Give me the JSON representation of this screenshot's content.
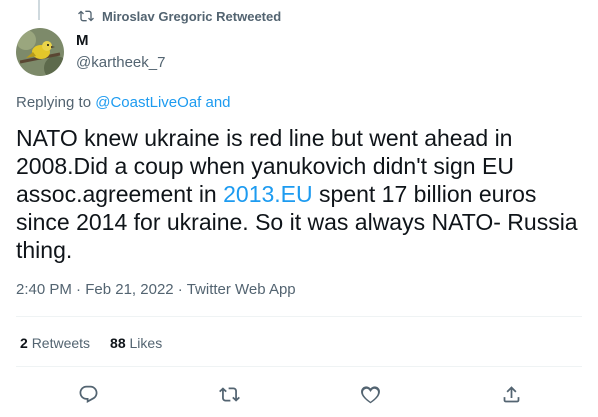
{
  "retweet_header": {
    "text": "Miroslav Gregoric Retweeted",
    "icon": "retweet-icon"
  },
  "author": {
    "display_name": "M",
    "handle": "@kartheek_7",
    "avatar": "bird-on-branch-avatar"
  },
  "reply_context": {
    "prefix": "Replying to",
    "mention": "@CoastLiveOaf",
    "suffix": "and"
  },
  "tweet": {
    "text_before_link": "NATO knew ukraine is red line but went ahead in 2008.Did a coup when yanukovich didn't sign EU assoc.agreement in",
    "link_text": "2013.EU",
    "text_after_link": "spent 17 billion euros since 2014 for ukraine. So it was always NATO- Russia thing."
  },
  "meta": {
    "time": "2:40 PM",
    "separator": "·",
    "date": "Feb 21, 2022",
    "source": "Twitter Web App"
  },
  "stats": {
    "retweets_count": "2",
    "retweets_label": "Retweets",
    "likes_count": "88",
    "likes_label": "Likes"
  },
  "actions": [
    {
      "name": "reply",
      "icon": "reply-bubble-icon"
    },
    {
      "name": "retweet",
      "icon": "retweet-icon"
    },
    {
      "name": "like",
      "icon": "heart-icon"
    },
    {
      "name": "share",
      "icon": "share-upload-icon"
    }
  ],
  "colors": {
    "accent": "#1d9bf0",
    "secondary_text": "#536471",
    "primary_text": "#0f1419",
    "divider": "#eff3f4"
  }
}
